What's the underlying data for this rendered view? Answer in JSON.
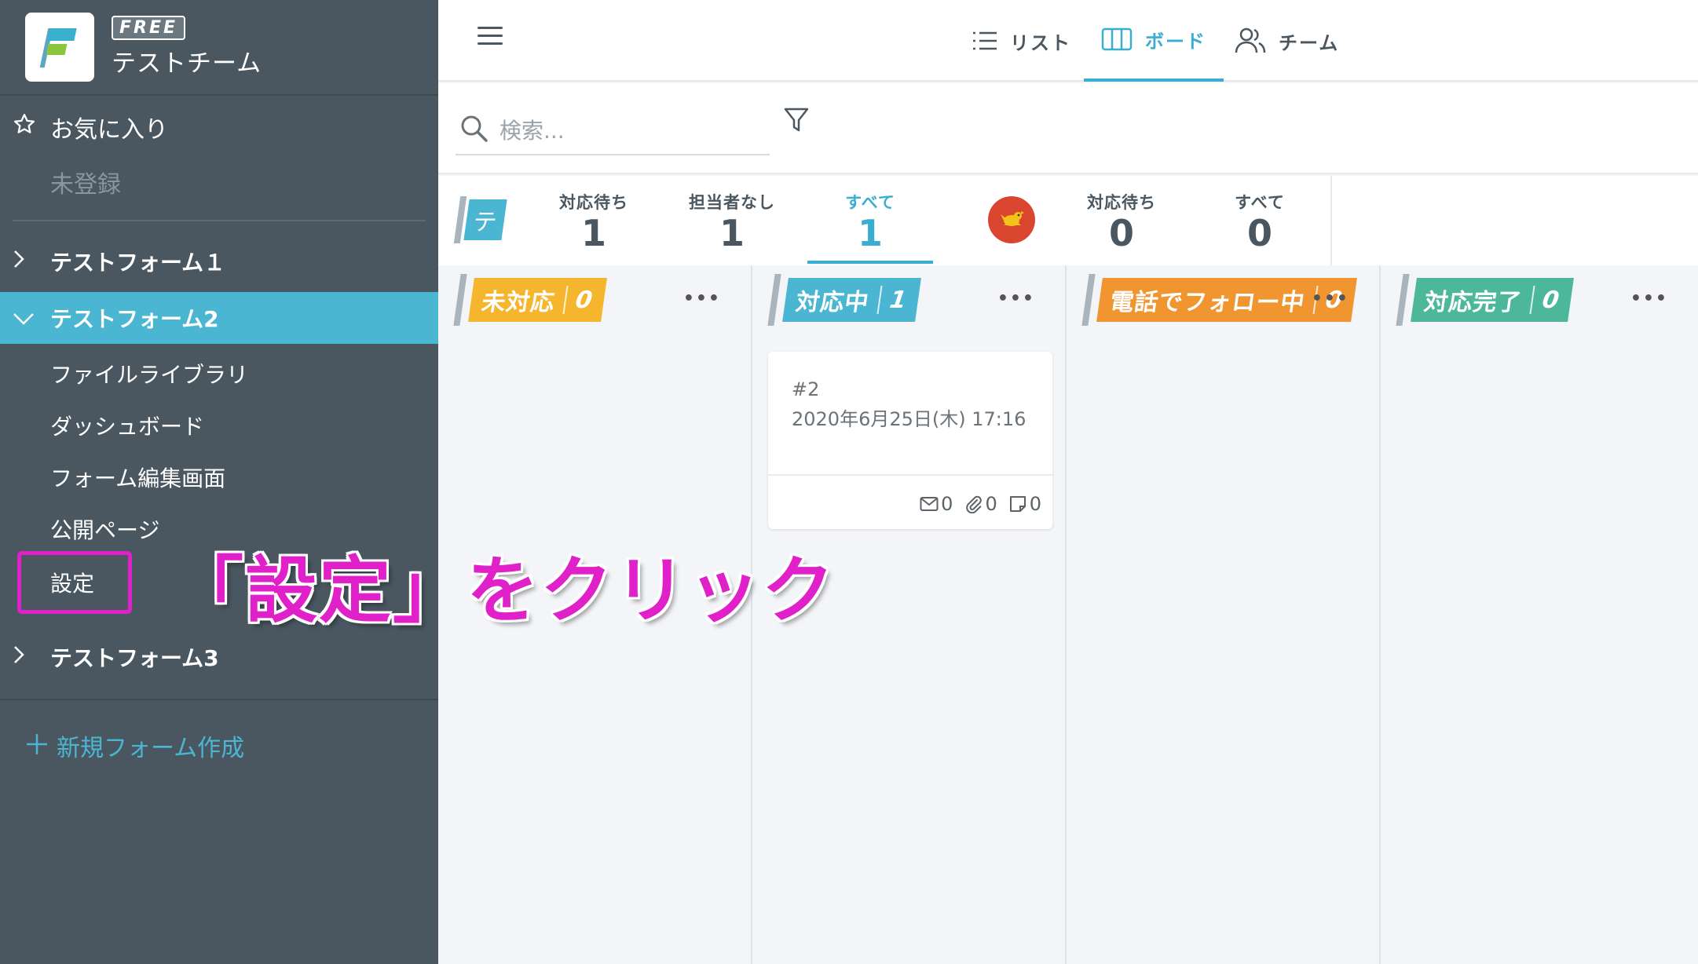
{
  "sidebar": {
    "badge": "FREE",
    "team_name": "テストチーム",
    "favorites_label": "お気に入り",
    "unregistered": "未登録",
    "forms": [
      {
        "label": "テストフォーム１"
      },
      {
        "label": "テストフォーム2"
      },
      {
        "label": "テストフォーム3"
      }
    ],
    "sub_items": [
      "ファイルライブラリ",
      "ダッシュボード",
      "フォーム編集画面",
      "公開ページ",
      "設定"
    ],
    "new_form": "新規フォーム作成"
  },
  "topnav": {
    "tabs": [
      {
        "label": "リスト",
        "icon": "list-icon"
      },
      {
        "label": "ボード",
        "icon": "board-icon",
        "active": true
      },
      {
        "label": "チーム",
        "icon": "team-icon"
      }
    ]
  },
  "search": {
    "placeholder": "検索..."
  },
  "stats": {
    "team_initial": "テ",
    "team_stats": [
      {
        "label": "対応待ち",
        "value": "1"
      },
      {
        "label": "担当者なし",
        "value": "1"
      },
      {
        "label": "すべて",
        "value": "1",
        "active": true
      }
    ],
    "user_stats": [
      {
        "label": "対応待ち",
        "value": "0"
      },
      {
        "label": "すべて",
        "value": "0"
      }
    ]
  },
  "board": {
    "columns": [
      {
        "label": "未対応",
        "count": "0",
        "color": "#f5b62e"
      },
      {
        "label": "対応中",
        "count": "1",
        "color": "#4ab6d2"
      },
      {
        "label": "電話でフォロー中",
        "count": "0",
        "color": "#f0952f"
      },
      {
        "label": "対応完了",
        "count": "0",
        "color": "#4db79a"
      }
    ],
    "card": {
      "id": "#2",
      "date": "2020年6月25日(木) 17:16",
      "mail_count": "0",
      "attach_count": "0",
      "note_count": "0"
    },
    "more": "•••"
  },
  "annotation": "「設定」をクリック",
  "colors": {
    "sidebar_bg": "#4a5760",
    "accent": "#4ab6d2",
    "annotation": "#e020c8"
  }
}
